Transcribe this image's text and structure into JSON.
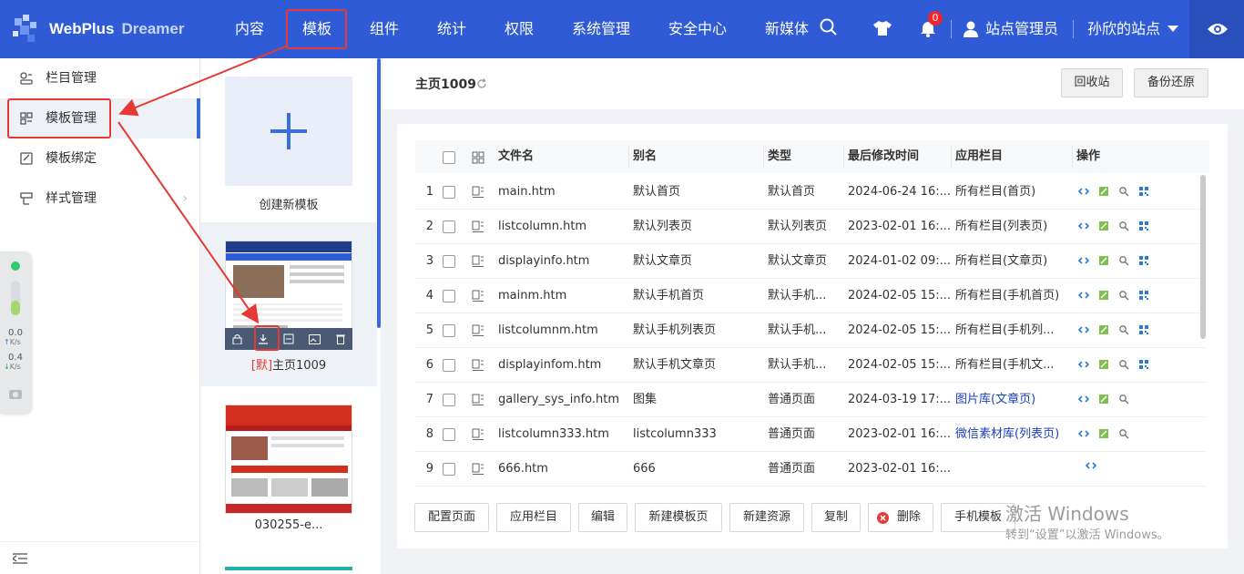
{
  "app": {
    "brand": "WebPlus",
    "brand_sub": "Dreamer"
  },
  "topnav": {
    "items": [
      "内容",
      "模板",
      "组件",
      "统计",
      "权限",
      "系统管理",
      "安全中心",
      "新媒体"
    ],
    "active": "模板",
    "notifications": "0",
    "user": "站点管理员",
    "site": "孙欣的站点"
  },
  "sidebar": {
    "items": [
      "栏目管理",
      "模板管理",
      "模板绑定",
      "样式管理"
    ],
    "active": "模板管理"
  },
  "float_panel": {
    "up_value": "0.0",
    "up_unit": "K/s",
    "down_value": "0.4",
    "down_unit": "K/s"
  },
  "templates": {
    "create_label": "创建新模板",
    "items": [
      {
        "tag": "[默]",
        "name": "主页1009"
      },
      {
        "name": "030255-e..."
      }
    ]
  },
  "main": {
    "title": "主页1009",
    "recycle_label": "回收站",
    "backup_label": "备份还原",
    "columns": [
      "文件名",
      "别名",
      "类型",
      "最后修改时间",
      "应用栏目",
      "操作"
    ],
    "rows": [
      {
        "n": "1",
        "file": "main.htm",
        "alias": "默认首页",
        "type": "默认首页",
        "time": "2024-06-24 16:...",
        "col": "所有栏目(首页)",
        "link": false,
        "acts": 4
      },
      {
        "n": "2",
        "file": "listcolumn.htm",
        "alias": "默认列表页",
        "type": "默认列表页",
        "time": "2023-02-01 16:...",
        "col": "所有栏目(列表页)",
        "link": false,
        "acts": 4
      },
      {
        "n": "3",
        "file": "displayinfo.htm",
        "alias": "默认文章页",
        "type": "默认文章页",
        "time": "2024-01-02 09:...",
        "col": "所有栏目(文章页)",
        "link": false,
        "acts": 4
      },
      {
        "n": "4",
        "file": "mainm.htm",
        "alias": "默认手机首页",
        "type": "默认手机...",
        "time": "2024-02-05 15:...",
        "col": "所有栏目(手机首页)",
        "link": false,
        "acts": 4
      },
      {
        "n": "5",
        "file": "listcolumnm.htm",
        "alias": "默认手机列表页",
        "type": "默认手机...",
        "time": "2024-02-05 15:...",
        "col": "所有栏目(手机列...",
        "link": false,
        "acts": 4
      },
      {
        "n": "6",
        "file": "displayinfom.htm",
        "alias": "默认手机文章页",
        "type": "默认手机...",
        "time": "2024-02-05 15:...",
        "col": "所有栏目(手机文...",
        "link": false,
        "acts": 4
      },
      {
        "n": "7",
        "file": "gallery_sys_info.htm",
        "alias": "图集",
        "type": "普通页面",
        "time": "2024-03-19 17:...",
        "col": "图片库(文章页)",
        "link": true,
        "acts": 3
      },
      {
        "n": "8",
        "file": "listcolumn333.htm",
        "alias": "listcolumn333",
        "type": "普通页面",
        "time": "2023-02-01 16:...",
        "col": "微信素材库(列表页)",
        "link": true,
        "acts": 3
      },
      {
        "n": "9",
        "file": "666.htm",
        "alias": "666",
        "type": "普通页面",
        "time": "2023-02-01 16:...",
        "col": "",
        "link": false,
        "acts": 1
      }
    ],
    "buttons": [
      "配置页面",
      "应用栏目",
      "编辑",
      "新建模板页",
      "新建资源",
      "复制",
      "删除",
      "手机模板"
    ]
  },
  "watermark": {
    "line1": "激活 Windows",
    "line2": "转到“设置”以激活 Windows。"
  }
}
